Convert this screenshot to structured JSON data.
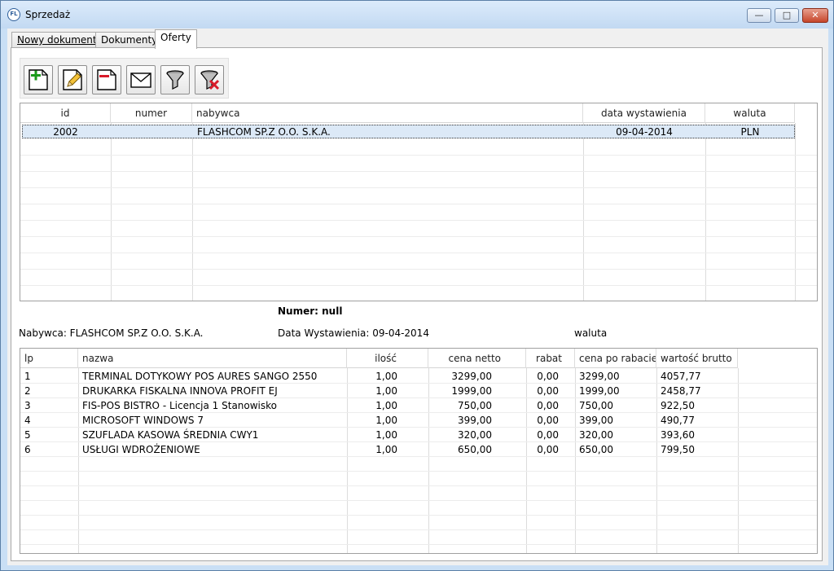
{
  "window": {
    "title": "Sprzedaż",
    "icon_text": "FL",
    "buttons": {
      "minimize": "—",
      "maximize": "□",
      "close": "✕"
    }
  },
  "tabs": [
    {
      "label": "Nowy dokument"
    },
    {
      "label": "Dokumenty"
    },
    {
      "label": "Oferty"
    }
  ],
  "toolbar": {
    "buttons": [
      {
        "icon": "new-document-icon"
      },
      {
        "icon": "edit-pencil-icon"
      },
      {
        "icon": "delete-document-icon"
      },
      {
        "icon": "envelope-icon"
      },
      {
        "icon": "filter-funnel-icon"
      },
      {
        "icon": "clear-filter-icon"
      }
    ]
  },
  "offers_table": {
    "columns": [
      "id",
      "numer",
      "nabywca",
      "data wystawienia",
      "waluta"
    ],
    "rows": [
      {
        "id": "2002",
        "numer": "",
        "nabywca": "FLASHCOM SP.Z O.O. S.K.A.",
        "data": "09-04-2014",
        "waluta": "PLN"
      }
    ]
  },
  "details": {
    "numer_label": "Numer: null",
    "nabywca_label": "Nabywca: FLASHCOM SP.Z O.O. S.K.A.",
    "data_label": "Data Wystawienia: 09-04-2014",
    "waluta_label": "waluta"
  },
  "items_table": {
    "columns": [
      "lp",
      "nazwa",
      "ilość",
      "cena netto",
      "rabat",
      "cena po rabacie",
      "wartość brutto"
    ],
    "rows": [
      {
        "lp": "1",
        "nazwa": "TERMINAL DOTYKOWY POS AURES SANGO 2550",
        "ilosc": "1,00",
        "netto": "3299,00",
        "rabat": "0,00",
        "po_rabacie": "3299,00",
        "brutto": "4057,77"
      },
      {
        "lp": "2",
        "nazwa": "DRUKARKA FISKALNA INNOVA PROFIT EJ",
        "ilosc": "1,00",
        "netto": "1999,00",
        "rabat": "0,00",
        "po_rabacie": "1999,00",
        "brutto": "2458,77"
      },
      {
        "lp": "3",
        "nazwa": "FIS-POS BISTRO - Licencja 1 Stanowisko",
        "ilosc": "1,00",
        "netto": "750,00",
        "rabat": "0,00",
        "po_rabacie": "750,00",
        "brutto": "922,50"
      },
      {
        "lp": "4",
        "nazwa": "MICROSOFT WINDOWS 7",
        "ilosc": "1,00",
        "netto": "399,00",
        "rabat": "0,00",
        "po_rabacie": "399,00",
        "brutto": "490,77"
      },
      {
        "lp": "5",
        "nazwa": "SZUFLADA KASOWA ŚREDNIA CWY1",
        "ilosc": "1,00",
        "netto": "320,00",
        "rabat": "0,00",
        "po_rabacie": "320,00",
        "brutto": "393,60"
      },
      {
        "lp": "6",
        "nazwa": "USŁUGI WDROŻENIOWE",
        "ilosc": "1,00",
        "netto": "650,00",
        "rabat": "0,00",
        "po_rabacie": "650,00",
        "brutto": "799,50"
      }
    ]
  },
  "colors": {
    "titlebar": "#c9dff5",
    "selection": "#dce9f7",
    "close_button": "#c6462a"
  }
}
